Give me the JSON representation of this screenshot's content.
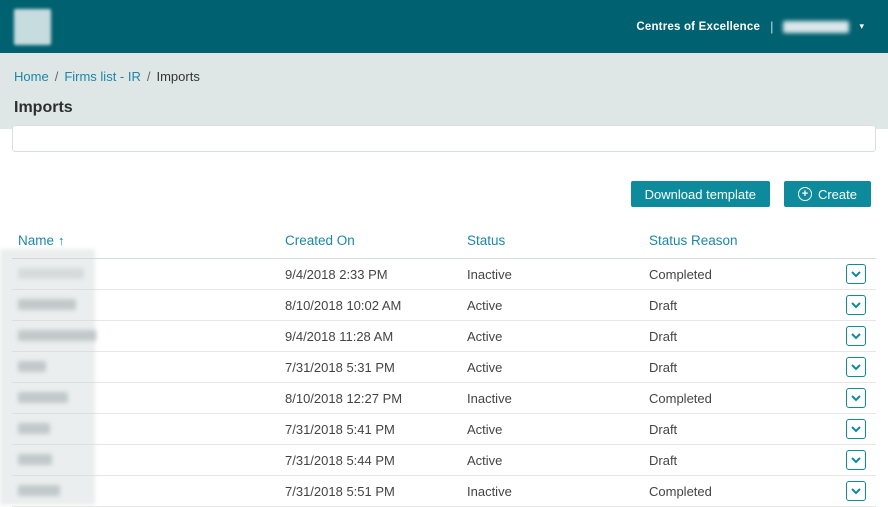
{
  "header": {
    "coe_label": "Centres of Excellence",
    "separator": "|",
    "user_caret": "▾"
  },
  "breadcrumb": {
    "separator": "/",
    "items": [
      {
        "label": "Home"
      },
      {
        "label": "Firms list - IR"
      },
      {
        "label": "Imports"
      }
    ]
  },
  "page_title": "Imports",
  "toolbar": {
    "download_template_label": "Download template",
    "create_label": "Create",
    "create_icon": "+"
  },
  "table": {
    "columns": [
      "Name",
      "Created On",
      "Status",
      "Status Reason"
    ],
    "sort": {
      "column": "Name",
      "direction": "asc",
      "icon": "↑"
    },
    "row_action_icon": "chevron-down",
    "rows": [
      {
        "created_on": "9/4/2018 2:33 PM",
        "status": "Inactive",
        "status_reason": "Completed"
      },
      {
        "created_on": "8/10/2018 10:02 AM",
        "status": "Active",
        "status_reason": "Draft"
      },
      {
        "created_on": "9/4/2018 11:28 AM",
        "status": "Active",
        "status_reason": "Draft"
      },
      {
        "created_on": "7/31/2018 5:31 PM",
        "status": "Active",
        "status_reason": "Draft"
      },
      {
        "created_on": "8/10/2018 12:27 PM",
        "status": "Inactive",
        "status_reason": "Completed"
      },
      {
        "created_on": "7/31/2018 5:41 PM",
        "status": "Active",
        "status_reason": "Draft"
      },
      {
        "created_on": "7/31/2018 5:44 PM",
        "status": "Active",
        "status_reason": "Draft"
      },
      {
        "created_on": "7/31/2018 5:51 PM",
        "status": "Inactive",
        "status_reason": "Completed"
      }
    ]
  },
  "colors": {
    "header_bg": "#006170",
    "accent": "#0d8b9c",
    "link": "#1d87a5",
    "band_bg": "#dfe6e6"
  }
}
